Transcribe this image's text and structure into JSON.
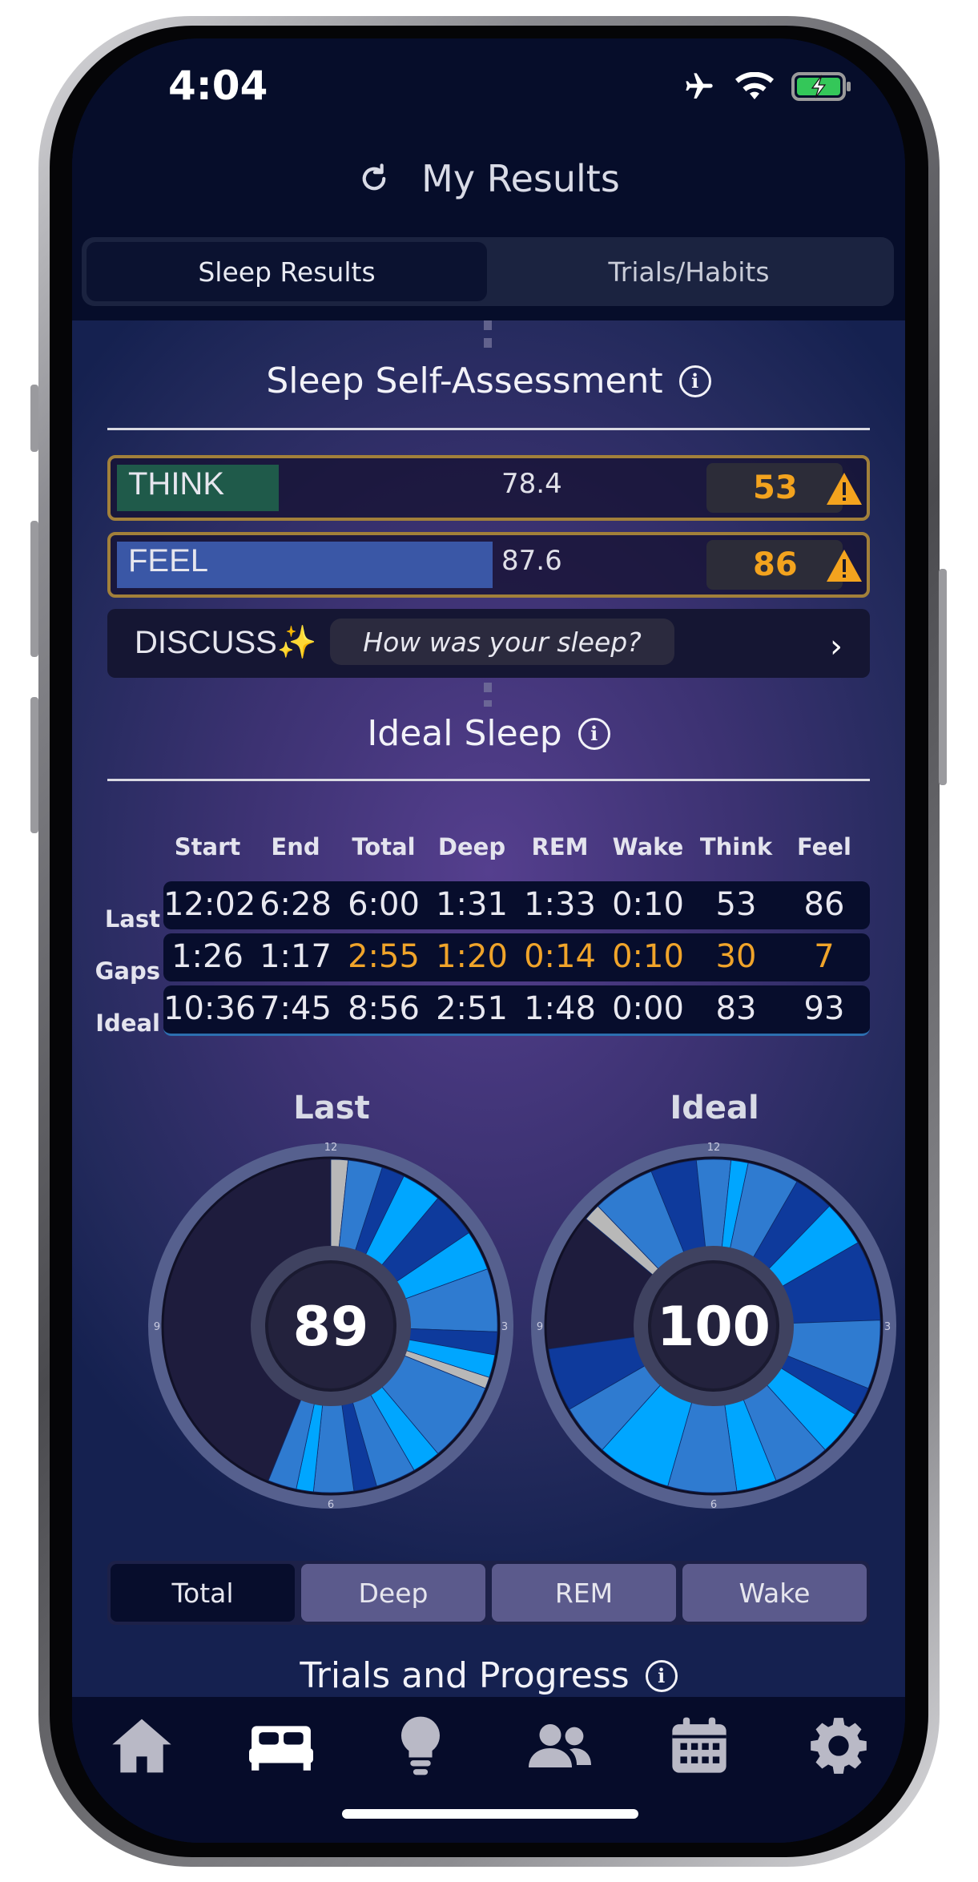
{
  "status": {
    "time": "4:04"
  },
  "header": {
    "title": "My Results"
  },
  "segments": {
    "sleep_results": "Sleep Results",
    "trials_habits": "Trials/Habits"
  },
  "self_assessment": {
    "title": "Sleep Self-Assessment",
    "think": {
      "label": "THINK",
      "mid_value": "78.4",
      "score": "53",
      "fill_fraction": 0.22,
      "bar_color": "#1f5a4a"
    },
    "feel": {
      "label": "FEEL",
      "mid_value": "87.6",
      "score": "86",
      "fill_fraction": 0.51,
      "bar_color": "#3a57a6"
    },
    "discuss": {
      "label": "DISCUSS✨",
      "prompt": "How was your sleep?"
    }
  },
  "ideal_sleep": {
    "title": "Ideal Sleep",
    "columns": [
      "Start",
      "End",
      "Total",
      "Deep",
      "REM",
      "Wake",
      "Think",
      "Feel"
    ],
    "rows": [
      {
        "label": "Last",
        "values": [
          "12:02",
          "6:28",
          "6:00",
          "1:31",
          "1:33",
          "0:10",
          "53",
          "86"
        ]
      },
      {
        "label": "Gaps",
        "values": [
          "1:26",
          "1:17",
          "2:55",
          "1:20",
          "0:14",
          "0:10",
          "30",
          "7"
        ]
      },
      {
        "label": "Ideal",
        "values": [
          "10:36",
          "7:45",
          "8:56",
          "2:51",
          "1:48",
          "0:00",
          "83",
          "93"
        ]
      }
    ]
  },
  "dials": {
    "last": {
      "title": "Last",
      "score": "89",
      "ticks": [
        "12",
        "3",
        "6",
        "9"
      ]
    },
    "ideal": {
      "title": "Ideal",
      "score": "100",
      "ticks": [
        "12",
        "3",
        "6",
        "9"
      ]
    }
  },
  "stage_tabs": [
    "Total",
    "Deep",
    "REM",
    "Wake"
  ],
  "next_section": {
    "title": "Trials and Progress"
  },
  "colors": {
    "accent_orange": "#f3a31e",
    "deep": "#0e3a9c",
    "rem": "#00a6ff",
    "light": "#2f7bd0",
    "wake": "#b8b8b8"
  },
  "bottom_nav": [
    "home-icon",
    "bed-icon",
    "lightbulb-icon",
    "people-icon",
    "calendar-icon",
    "gear-icon"
  ]
}
